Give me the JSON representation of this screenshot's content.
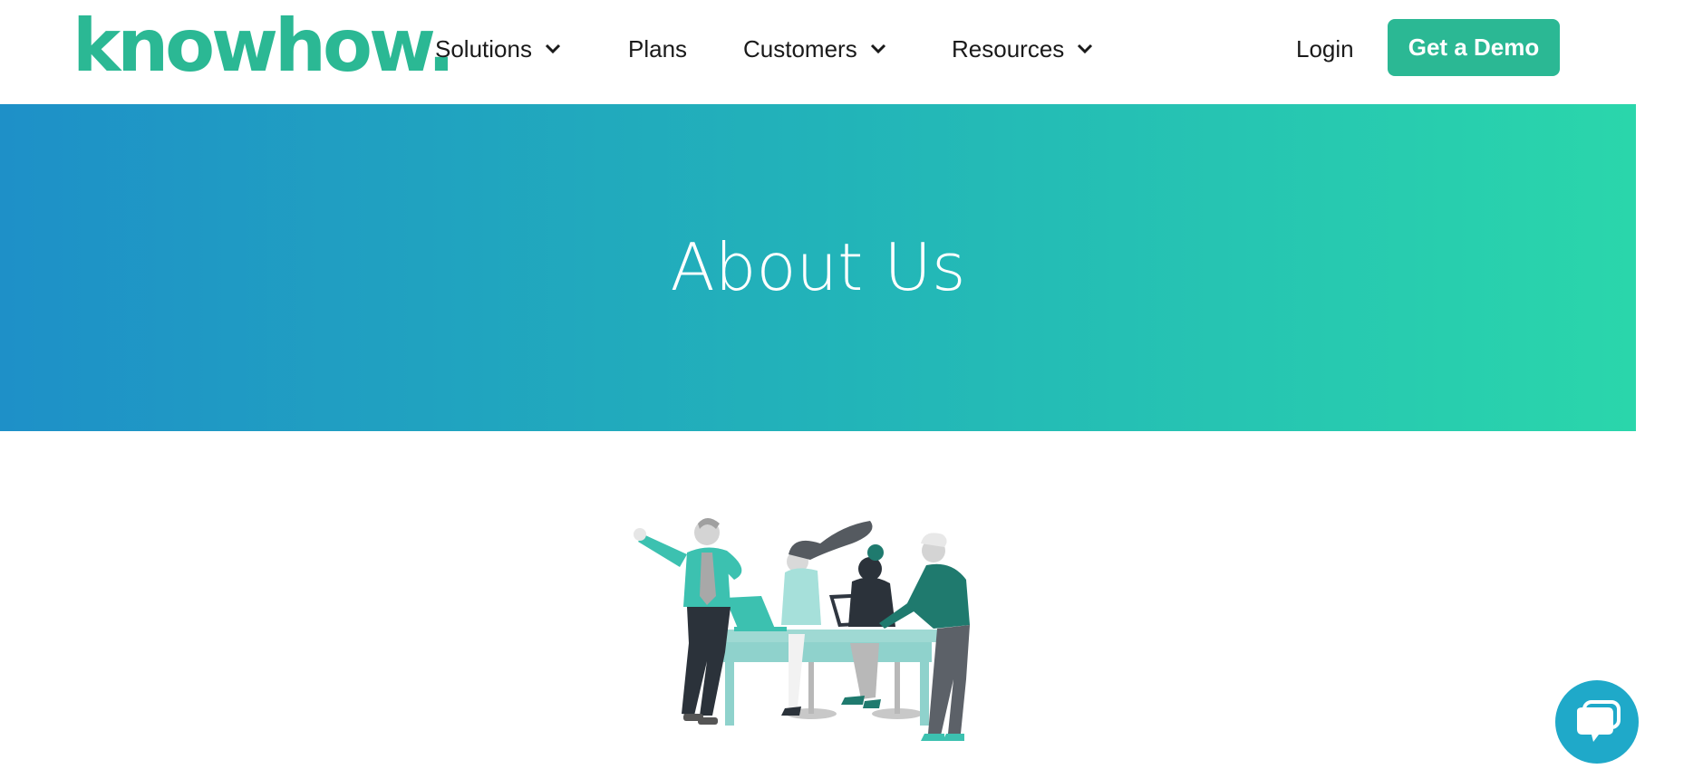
{
  "header": {
    "logo": "knowhow.",
    "nav": [
      {
        "label": "Solutions",
        "has_dropdown": true
      },
      {
        "label": "Plans",
        "has_dropdown": false
      },
      {
        "label": "Customers",
        "has_dropdown": true
      },
      {
        "label": "Resources",
        "has_dropdown": true
      }
    ],
    "login_label": "Login",
    "cta_label": "Get a Demo"
  },
  "hero": {
    "title": "About Us"
  },
  "icons": {
    "dropdown": "chevron-down-icon",
    "chat": "chat-bubble-icon",
    "illustration": "team-meeting-illustration"
  },
  "colors": {
    "brand": "#2bb894",
    "hero_gradient_start": "#1e90c8",
    "hero_gradient_end": "#2ad6ab",
    "chat_button": "#1fa9c9"
  }
}
